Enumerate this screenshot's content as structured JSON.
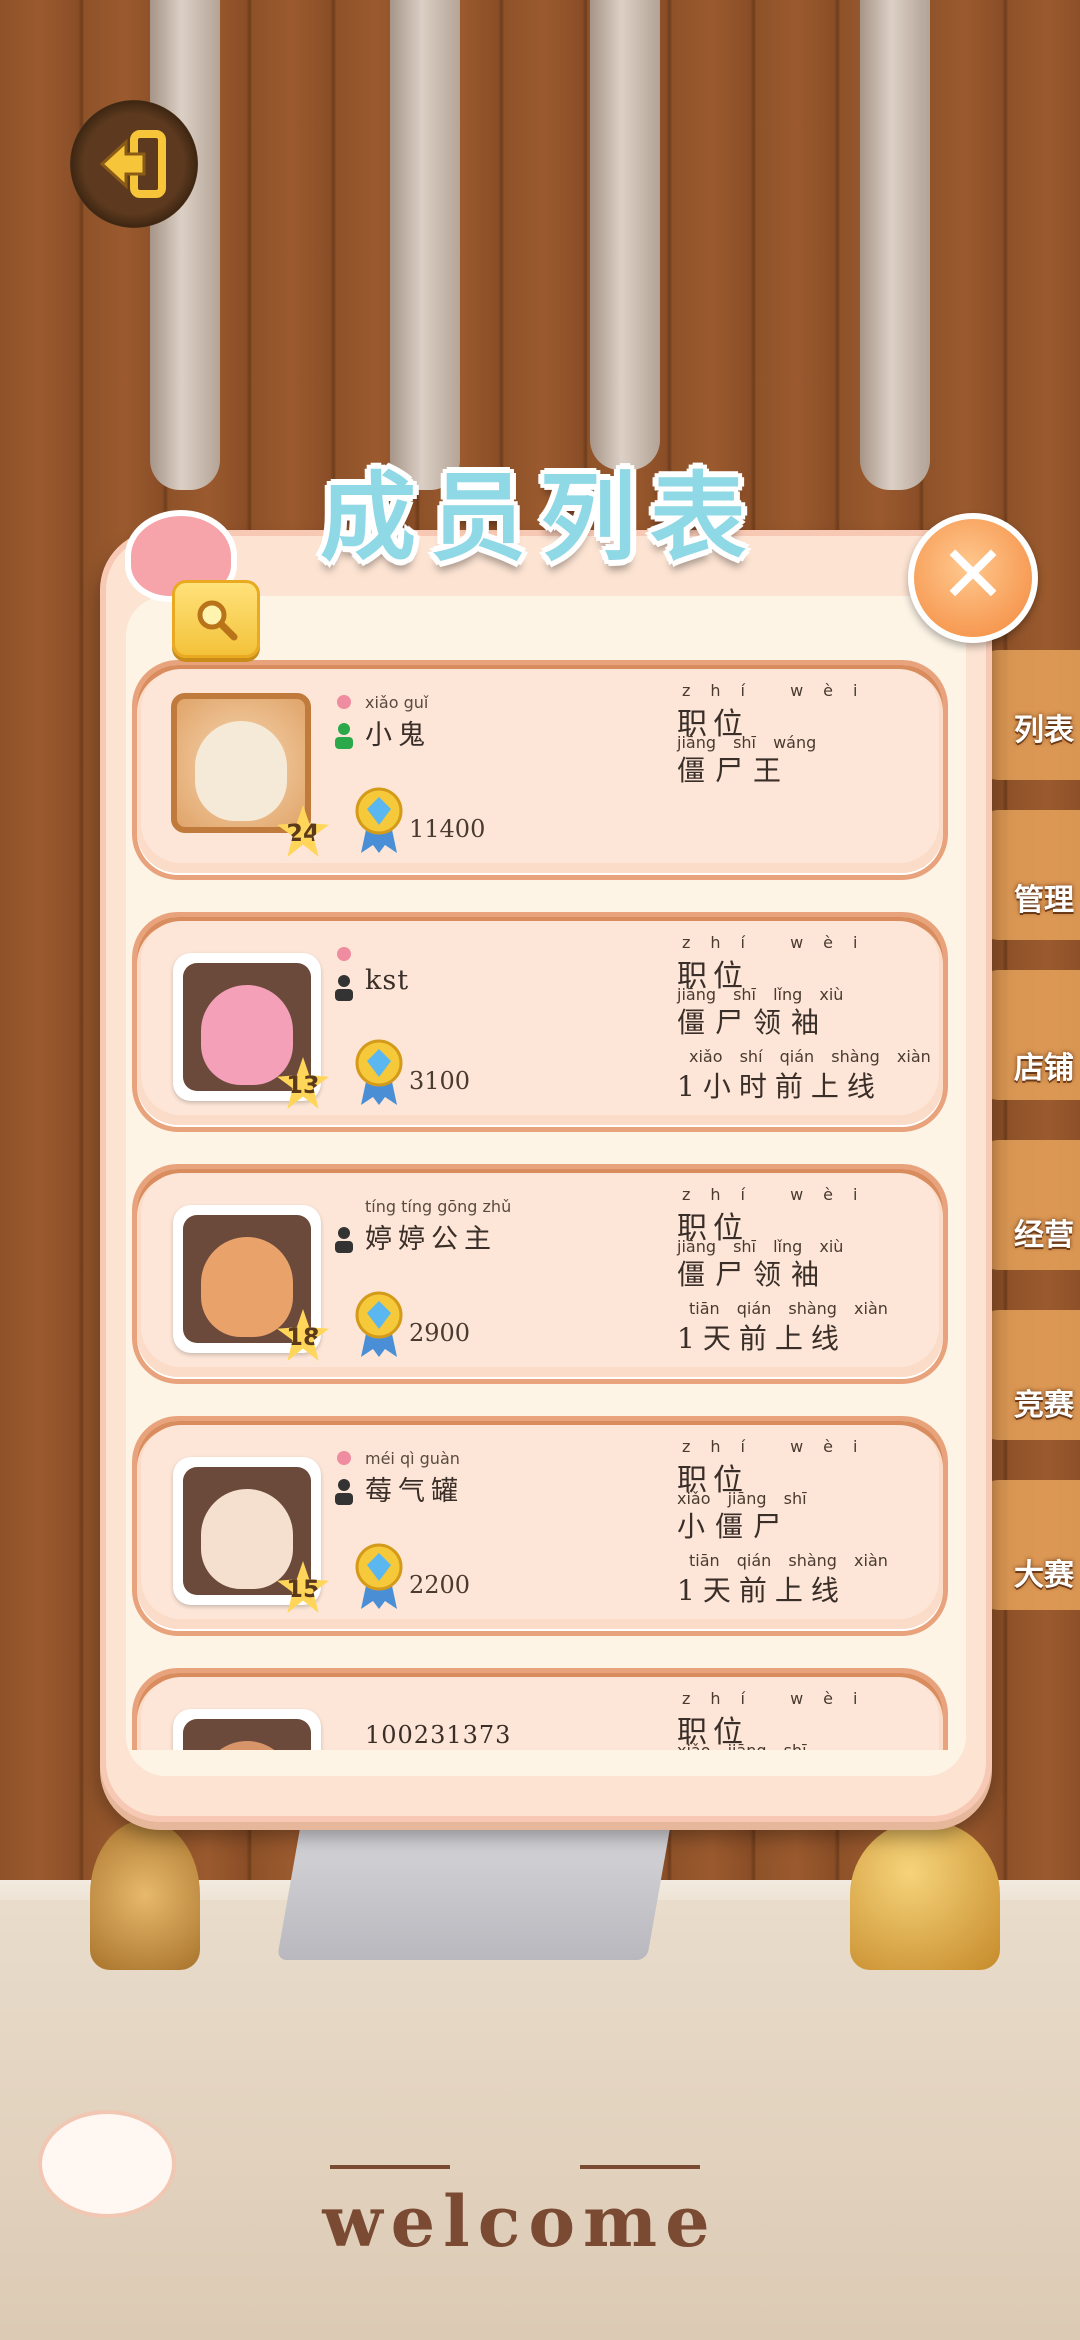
{
  "title": "成员列表",
  "side_menu": [
    "列表",
    "管理",
    "店铺",
    "经营",
    "竞赛",
    "大赛"
  ],
  "footer_text": "welcome",
  "position_label": "职位",
  "position_label_pinyin": "zhí wèi",
  "members": [
    {
      "name": "小鬼",
      "name_pinyin": "xiǎo guǐ",
      "level": "24",
      "score": "11400",
      "role": "僵尸王",
      "role_pinyin": "jiāng shī wáng",
      "online": "",
      "online_pinyin": "",
      "frame": "bread",
      "online_status": "online"
    },
    {
      "name": "kst",
      "name_pinyin": "",
      "level": "13",
      "score": "3100",
      "role": "僵尸领袖",
      "role_pinyin": "jiāng shī lǐng xiù",
      "online": "1小时前上线",
      "online_pinyin": "xiǎo shí qián shàng xiàn",
      "frame": "plain",
      "online_status": "offline"
    },
    {
      "name": "婷婷公主",
      "name_pinyin": "tíng tíng gōng zhǔ",
      "level": "18",
      "score": "2900",
      "role": "僵尸领袖",
      "role_pinyin": "jiāng shī lǐng xiù",
      "online": "1天前上线",
      "online_pinyin": "tiān qián shàng xiàn",
      "frame": "plain",
      "online_status": "offline"
    },
    {
      "name": "莓气罐",
      "name_pinyin": "méi qì guàn",
      "level": "15",
      "score": "2200",
      "role": "小僵尸",
      "role_pinyin": "xiǎo jiāng shī",
      "online": "1天前上线",
      "online_pinyin": "tiān qián shàng xiàn",
      "frame": "plain",
      "online_status": "offline"
    },
    {
      "name": "100231373",
      "name_pinyin": "",
      "level": "",
      "score": "",
      "role": "",
      "role_pinyin": "xiǎo jiāng shī",
      "online": "",
      "online_pinyin": "",
      "frame": "plain",
      "online_status": "offline"
    }
  ],
  "colors": {
    "title": "#8fd8e6",
    "card_bg": "#fde6d8",
    "close": "#f3883c",
    "online": "#2aa84a",
    "offline": "#333333"
  }
}
